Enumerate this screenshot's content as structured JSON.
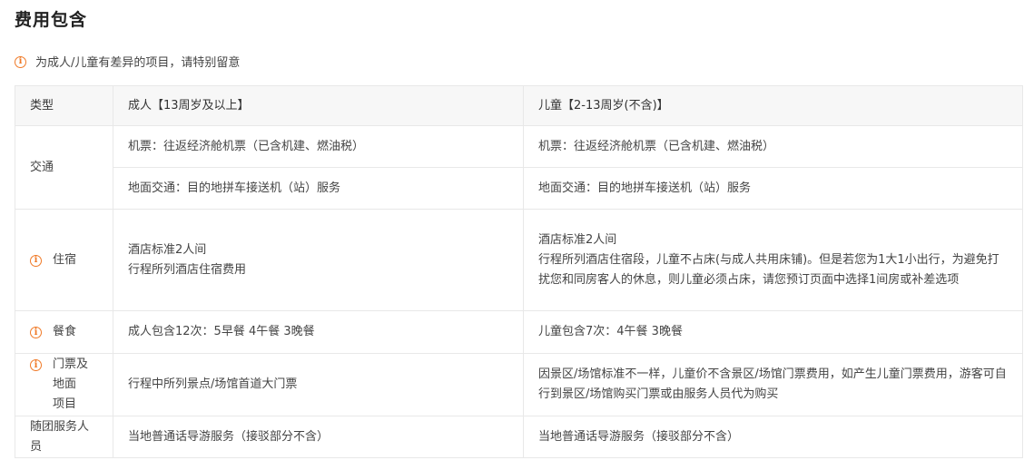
{
  "section": {
    "title": "费用包含",
    "notice": "为成人/儿童有差异的项目，请特别留意"
  },
  "table": {
    "headers": {
      "type": "类型",
      "adult": "成人【13周岁及以上】",
      "child": "儿童【2-13周岁(不含)】"
    },
    "rows": {
      "transport": {
        "type": "交通",
        "flight_adult": "机票：往返经济舱机票（已含机建、燃油税）",
        "flight_child": "机票：往返经济舱机票（已含机建、燃油税）",
        "ground_adult": "地面交通：目的地拼车接送机（站）服务",
        "ground_child": "地面交通：目的地拼车接送机（站）服务"
      },
      "lodging": {
        "type": "住宿",
        "adult_line1": "酒店标准2人间",
        "adult_line2": "行程所列酒店住宿费用",
        "child_line1": "酒店标准2人间",
        "child_line2": "行程所列酒店住宿段，儿童不占床(与成人共用床铺)。但是若您为1大1小出行，为避免打扰您和同房客人的休息，则儿童必须占床，请您预订页面中选择1间房或补差选项"
      },
      "meals": {
        "type": "餐食",
        "adult": "成人包含12次：5早餐 4午餐 3晚餐",
        "child": "儿童包含7次：4午餐 3晚餐"
      },
      "tickets": {
        "type_line1": "门票及地面",
        "type_line2": "项目",
        "adult": "行程中所列景点/场馆首道大门票",
        "child": "因景区/场馆标准不一样，儿童价不含景区/场馆门票费用，如产生儿童门票费用，游客可自行到景区/场馆购买门票或由服务人员代为购买"
      },
      "guide": {
        "type": "随团服务人员",
        "adult": "当地普通话导游服务（接驳部分不含）",
        "child": "当地普通话导游服务（接驳部分不含）"
      }
    }
  },
  "icons": {
    "info": "info-circle-icon",
    "info_glyph": "i",
    "accent_color": "#f07a28"
  }
}
